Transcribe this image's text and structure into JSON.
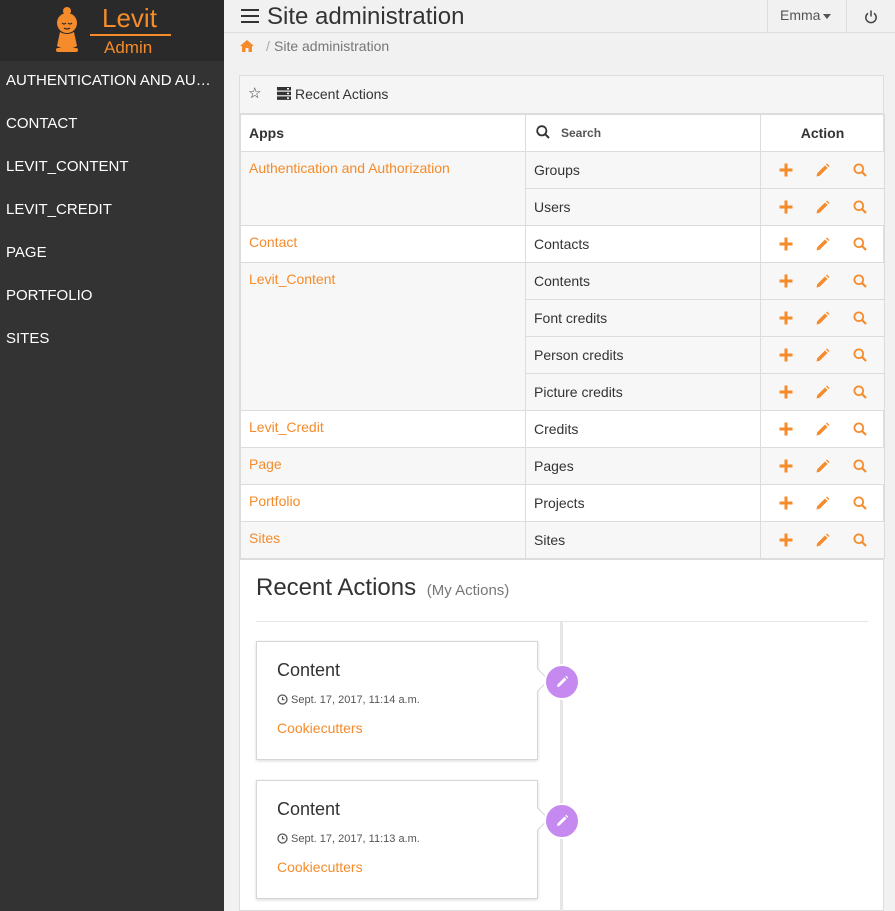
{
  "brand": {
    "name": "Levit",
    "sub": "Admin"
  },
  "sidebar": {
    "items": [
      {
        "label": "AUTHENTICATION AND AUTHORIZATION"
      },
      {
        "label": "CONTACT"
      },
      {
        "label": "LEVIT_CONTENT"
      },
      {
        "label": "LEVIT_CREDIT"
      },
      {
        "label": "PAGE"
      },
      {
        "label": "PORTFOLIO"
      },
      {
        "label": "SITES"
      }
    ]
  },
  "header": {
    "title": "Site administration",
    "user": "Emma"
  },
  "breadcrumb": {
    "current": "Site administration",
    "separator": "/"
  },
  "card": {
    "header_label": "Recent Actions"
  },
  "table": {
    "col_apps": "Apps",
    "search_placeholder": "Search",
    "col_action": "Action",
    "rows": [
      {
        "app": "Authentication and Authorization",
        "model": "Groups"
      },
      {
        "app": "",
        "model": "Users"
      },
      {
        "app": "Contact",
        "model": "Contacts"
      },
      {
        "app": "Levit_Content",
        "model": "Contents"
      },
      {
        "app": "",
        "model": "Font credits"
      },
      {
        "app": "",
        "model": "Person credits"
      },
      {
        "app": "",
        "model": "Picture credits"
      },
      {
        "app": "Levit_Credit",
        "model": "Credits"
      },
      {
        "app": "Page",
        "model": "Pages"
      },
      {
        "app": "Portfolio",
        "model": "Projects"
      },
      {
        "app": "Sites",
        "model": "Sites"
      }
    ]
  },
  "recent": {
    "title": "Recent Actions",
    "subtitle": "(My Actions)",
    "items": [
      {
        "title": "Content",
        "time": "Sept. 17, 2017, 11:14 a.m.",
        "link": "Cookiecutters"
      },
      {
        "title": "Content",
        "time": "Sept. 17, 2017, 11:13 a.m.",
        "link": "Cookiecutters"
      }
    ]
  },
  "colors": {
    "accent": "#f58b2a",
    "sidebar": "#333333",
    "badge": "#c689f0"
  }
}
